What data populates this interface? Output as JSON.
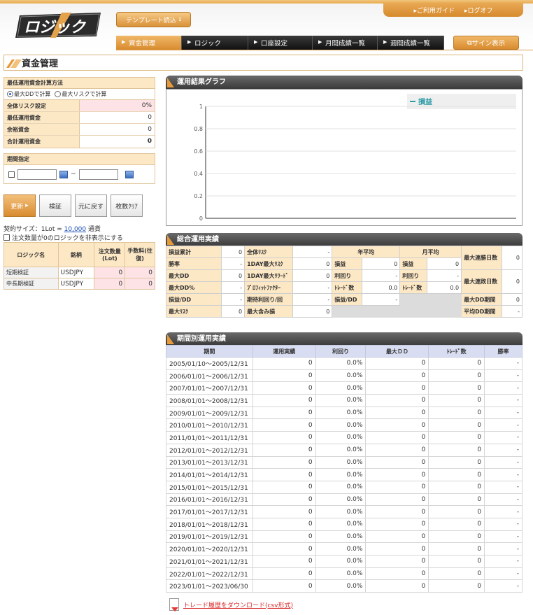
{
  "header": {
    "logo_text": "ロジック",
    "template_button": "テンプレート読込",
    "guide_link": "ご利用ガイド",
    "logout_link": "ログオフ",
    "nav": [
      "資金管理",
      "ロジック",
      "口座設定",
      "月間成績一覧",
      "週間成績一覧"
    ],
    "sign_button": "サイン表示"
  },
  "page_title": "資金管理",
  "left": {
    "calc_method_head": "最低運用資金計算方法",
    "radio_dd": "最大DDで計算",
    "radio_risk": "最大リスクで計算",
    "rows": [
      {
        "label": "全体リスク設定",
        "value": "0%"
      },
      {
        "label": "最低運用資金",
        "value": "0"
      },
      {
        "label": "余裕資金",
        "value": "0"
      },
      {
        "label": "合計運用資金",
        "value": "0"
      }
    ],
    "period_head": "期間指定",
    "date_sep": "~",
    "buttons": {
      "update": "更新",
      "verify": "検証",
      "restore": "元に戻す",
      "clear": "枚数ｸﾘｱ"
    },
    "contract_prefix": "契約サイズ：1Lot = ",
    "contract_value": "10,000",
    "contract_suffix": " 通貨",
    "hide_zero": "注文数量が0のロジックを非表示にする",
    "logic_headers": [
      "ロジック名",
      "銘柄",
      "注文数量(Lot)",
      "手数料(往復)"
    ],
    "logic_rows": [
      {
        "name": "短期検証",
        "symbol": "USDJPY",
        "qty": "0",
        "fee": "0"
      },
      {
        "name": "中長期検証",
        "symbol": "USDJPY",
        "qty": "0",
        "fee": "0"
      }
    ]
  },
  "graph": {
    "title": "運用結果グラフ",
    "legend": "損益",
    "yticks": [
      "1",
      "0.8",
      "0.6",
      "0.4",
      "0.2",
      "0"
    ]
  },
  "chart_data": {
    "type": "line",
    "series": [
      {
        "name": "損益",
        "values": []
      }
    ],
    "ylim": [
      0,
      1
    ],
    "yticks": [
      0,
      0.2,
      0.4,
      0.6,
      0.8,
      1
    ]
  },
  "summary": {
    "title": "総合運用実績",
    "year_avg": "年平均",
    "month_avg": "月平均",
    "c1": [
      [
        "損益累計",
        "0"
      ],
      [
        "勝率",
        "-"
      ],
      [
        "最大DD",
        "0"
      ],
      [
        "最大DD%",
        "-"
      ],
      [
        "損益/DD",
        "-"
      ],
      [
        "最大ﾘｽｸ",
        "0"
      ]
    ],
    "c2": [
      [
        "全体ﾘｽｸ",
        "-"
      ],
      [
        "1DAY最大ﾘｽｸ",
        "0"
      ],
      [
        "1DAY最大ﾘﾜｰﾄﾞ",
        "0"
      ],
      [
        "ﾌﾟﾛﾌｨｯﾄﾌｧｸﾀｰ",
        "-"
      ],
      [
        "期待利回り/回",
        "-"
      ],
      [
        "最大含み損",
        "0"
      ]
    ],
    "c3": [
      [
        "損益",
        "0"
      ],
      [
        "利回り",
        "-"
      ],
      [
        "ﾄﾚｰﾄﾞ数",
        "0.0"
      ],
      [
        "損益/DD",
        "-"
      ]
    ],
    "c4": [
      [
        "損益",
        "0"
      ],
      [
        "利回り",
        "-"
      ],
      [
        "ﾄﾚｰﾄﾞ数",
        "0.0"
      ]
    ],
    "c5": [
      [
        "最大連勝日数",
        "0"
      ],
      [
        "最大連敗日数",
        "0"
      ],
      [
        "最大DD期間",
        "0"
      ],
      [
        "平均DD期間",
        "-"
      ]
    ]
  },
  "period": {
    "title": "期間別運用実績",
    "headers": [
      "期間",
      "運用実績",
      "利回り",
      "最大ＤＤ",
      "ﾄﾚｰﾄﾞ数",
      "勝率"
    ],
    "rows": [
      [
        "2005/01/10～2005/12/31",
        "0",
        "0.0%",
        "0",
        "0",
        "-"
      ],
      [
        "2006/01/01～2006/12/31",
        "0",
        "0.0%",
        "0",
        "0",
        "-"
      ],
      [
        "2007/01/01～2007/12/31",
        "0",
        "0.0%",
        "0",
        "0",
        "-"
      ],
      [
        "2008/01/01～2008/12/31",
        "0",
        "0.0%",
        "0",
        "0",
        "-"
      ],
      [
        "2009/01/01～2009/12/31",
        "0",
        "0.0%",
        "0",
        "0",
        "-"
      ],
      [
        "2010/01/01～2010/12/31",
        "0",
        "0.0%",
        "0",
        "0",
        "-"
      ],
      [
        "2011/01/01～2011/12/31",
        "0",
        "0.0%",
        "0",
        "0",
        "-"
      ],
      [
        "2012/01/01～2012/12/31",
        "0",
        "0.0%",
        "0",
        "0",
        "-"
      ],
      [
        "2013/01/01～2013/12/31",
        "0",
        "0.0%",
        "0",
        "0",
        "-"
      ],
      [
        "2014/01/01～2014/12/31",
        "0",
        "0.0%",
        "0",
        "0",
        "-"
      ],
      [
        "2015/01/01～2015/12/31",
        "0",
        "0.0%",
        "0",
        "0",
        "-"
      ],
      [
        "2016/01/01～2016/12/31",
        "0",
        "0.0%",
        "0",
        "0",
        "-"
      ],
      [
        "2017/01/01～2017/12/31",
        "0",
        "0.0%",
        "0",
        "0",
        "-"
      ],
      [
        "2018/01/01～2018/12/31",
        "0",
        "0.0%",
        "0",
        "0",
        "-"
      ],
      [
        "2019/01/01～2019/12/31",
        "0",
        "0.0%",
        "0",
        "0",
        "-"
      ],
      [
        "2020/01/01～2020/12/31",
        "0",
        "0.0%",
        "0",
        "0",
        "-"
      ],
      [
        "2021/01/01～2021/12/31",
        "0",
        "0.0%",
        "0",
        "0",
        "-"
      ],
      [
        "2022/01/01～2022/12/31",
        "0",
        "0.0%",
        "0",
        "0",
        "-"
      ],
      [
        "2023/01/01～2023/06/30",
        "0",
        "0.0%",
        "0",
        "0",
        "-"
      ]
    ]
  },
  "download_link": "トレード履歴をダウンロード(csv形式)",
  "colors": {
    "accent": "#d98b2f",
    "legend_line": "#2aa0a8",
    "pink": "#fde3e6",
    "head_bg": "#fde8c6"
  }
}
